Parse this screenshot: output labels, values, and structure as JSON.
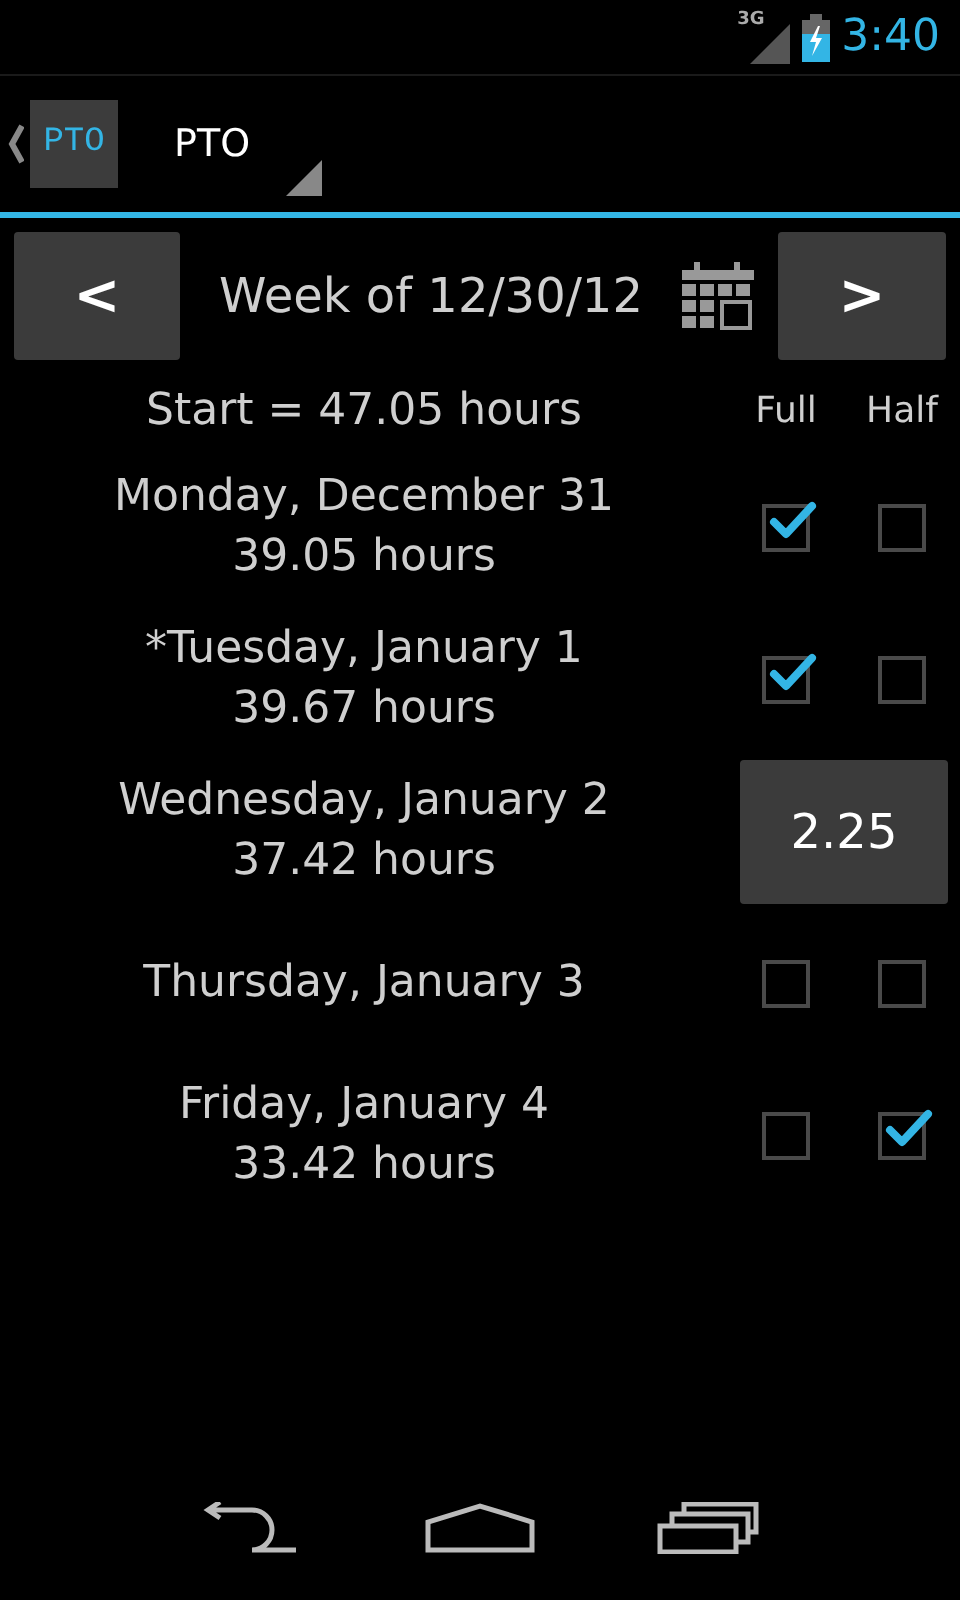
{
  "status_bar": {
    "network": "3G",
    "time": "3:40"
  },
  "action_bar": {
    "app_icon_text": "PTO",
    "title": "PTO"
  },
  "week_nav": {
    "prev": "<",
    "label": "Week of 12/30/12",
    "next": ">"
  },
  "summary": {
    "start": "Start = 47.05 hours",
    "full_header": "Full",
    "half_header": "Half"
  },
  "days": [
    {
      "kind": "checkboxes",
      "name": "Monday, December 31",
      "hours": "39.05 hours",
      "full": true,
      "half": false
    },
    {
      "kind": "checkboxes",
      "name": "*Tuesday, January 1",
      "hours": "39.67 hours",
      "full": true,
      "half": false
    },
    {
      "kind": "amount",
      "name": "Wednesday, January 2",
      "hours": "37.42 hours",
      "amount": "2.25"
    },
    {
      "kind": "checkboxes",
      "name": "Thursday, January 3",
      "full": false,
      "half": false
    },
    {
      "kind": "checkboxes",
      "name": "Friday, January 4",
      "hours": "33.42 hours",
      "full": false,
      "half": true
    }
  ]
}
